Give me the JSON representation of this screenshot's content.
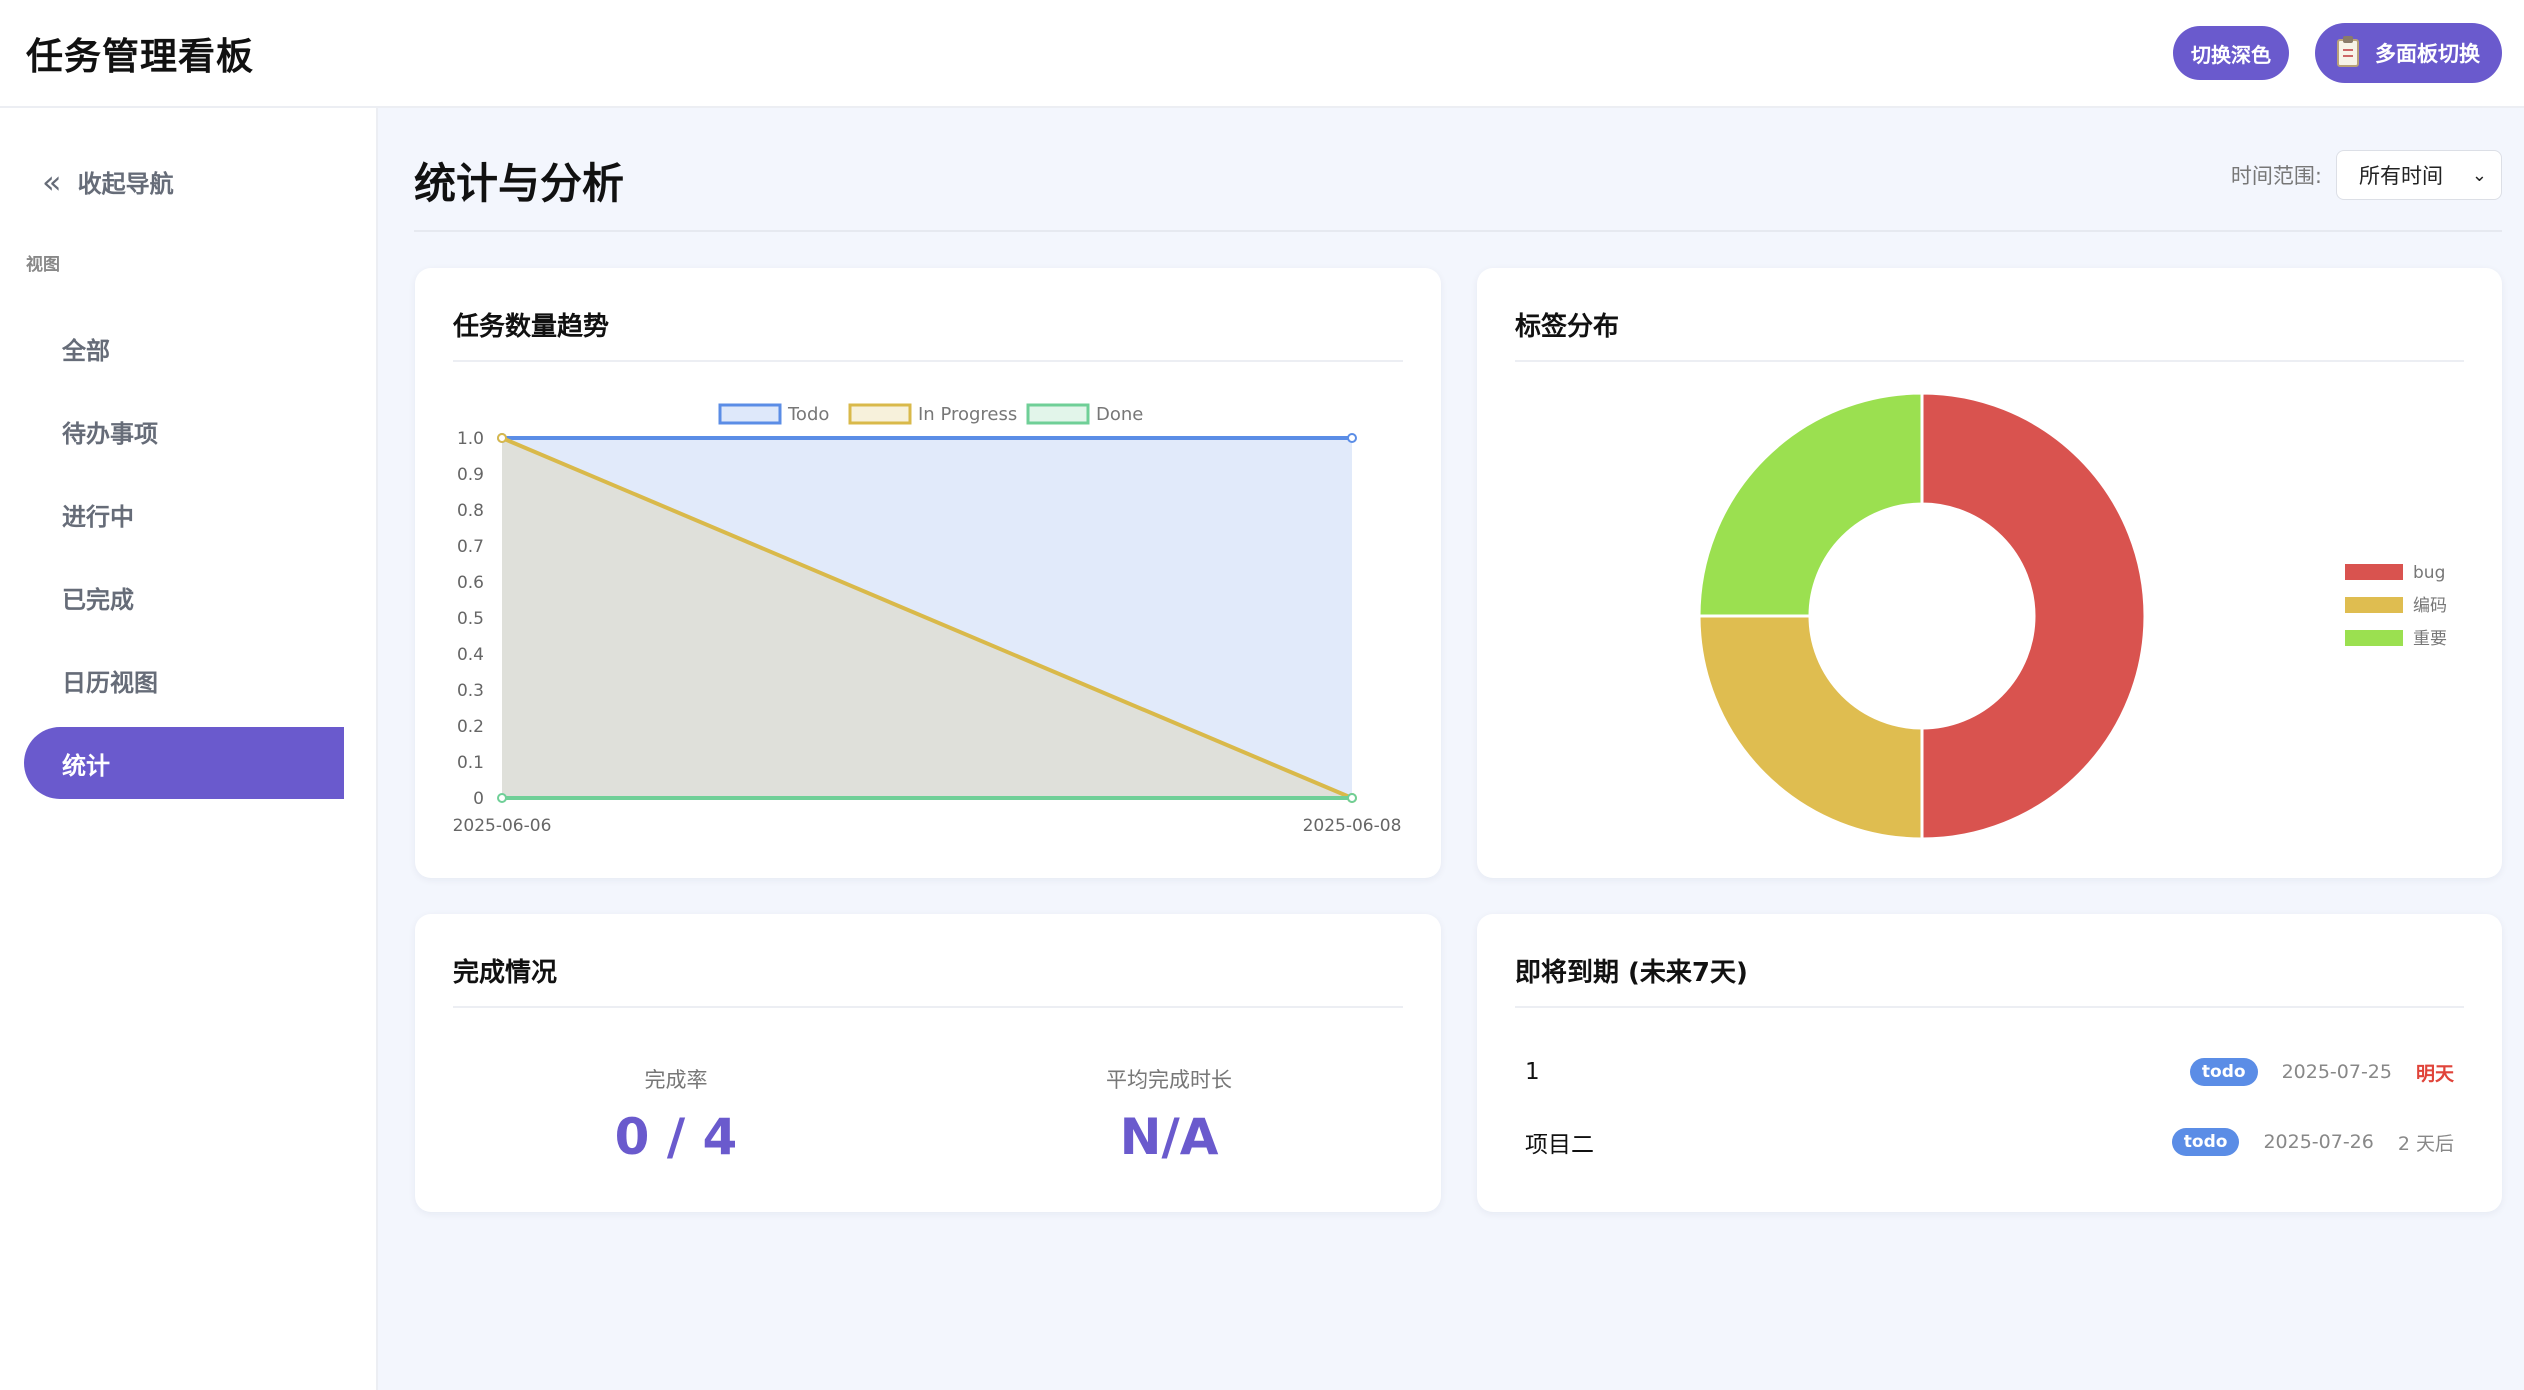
{
  "header": {
    "title": "任务管理看板",
    "theme_button": "切换深色",
    "board_button": "多面板切换"
  },
  "sidebar": {
    "collapse_label": "收起导航",
    "section_label": "视图",
    "items": [
      {
        "label": "全部",
        "active": false
      },
      {
        "label": "待办事项",
        "active": false
      },
      {
        "label": "进行中",
        "active": false
      },
      {
        "label": "已完成",
        "active": false
      },
      {
        "label": "日历视图",
        "active": false
      },
      {
        "label": "统计",
        "active": true
      }
    ]
  },
  "main": {
    "title": "统计与分析",
    "range_label": "时间范围:",
    "range_value": "所有时间"
  },
  "trend_card": {
    "title": "任务数量趋势"
  },
  "tags_card": {
    "title": "标签分布"
  },
  "completion_card": {
    "title": "完成情况",
    "rate_label": "完成率",
    "rate_value": "0 / 4",
    "avg_label": "平均完成时长",
    "avg_value": "N/A"
  },
  "due_card": {
    "title": "即将到期 (未来7天)",
    "items": [
      {
        "name": "1",
        "status": "todo",
        "date": "2025-07-25",
        "relative": "明天",
        "urgent": true
      },
      {
        "name": "项目二",
        "status": "todo",
        "date": "2025-07-26",
        "relative": "2 天后",
        "urgent": false
      }
    ]
  },
  "colors": {
    "accent": "#6a5acd",
    "todo": "#5b8de6",
    "in_progress": "#d9b94a",
    "done": "#6fcf97",
    "bug": "#d9534f",
    "coding": "#dfbd50",
    "important": "#9be050"
  },
  "chart_data": [
    {
      "type": "area",
      "x": [
        "2025-06-06",
        "2025-06-08"
      ],
      "ylim": [
        0,
        1
      ],
      "yticks": [
        "1.0",
        "0.9",
        "0.8",
        "0.7",
        "0.6",
        "0.5",
        "0.4",
        "0.3",
        "0.2",
        "0.1",
        "0"
      ],
      "legend_position": "top",
      "series": [
        {
          "name": "Todo",
          "values": [
            1,
            1
          ],
          "color": "#5b8de6"
        },
        {
          "name": "In Progress",
          "values": [
            1,
            0
          ],
          "color": "#d9b94a"
        },
        {
          "name": "Done",
          "values": [
            0,
            0
          ],
          "color": "#6fcf97"
        }
      ]
    },
    {
      "type": "pie",
      "legend_position": "right",
      "labels": [
        "bug",
        "编码",
        "重要"
      ],
      "values": [
        2,
        1,
        1
      ],
      "colors": [
        "#d9534f",
        "#dfbd50",
        "#9be050"
      ]
    }
  ]
}
